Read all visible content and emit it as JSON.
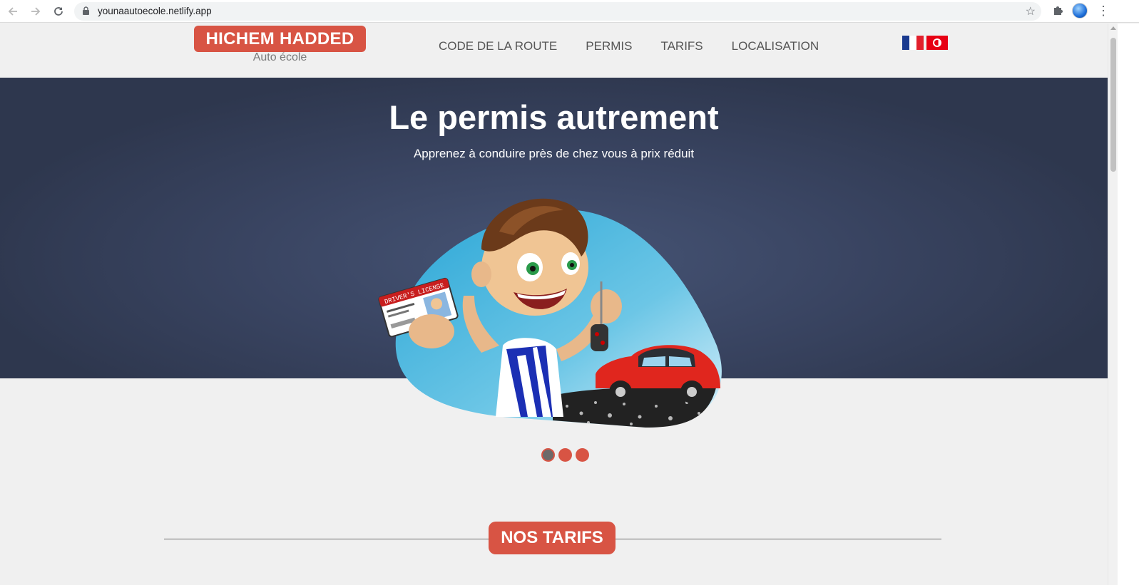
{
  "browser": {
    "url": "younaautoecole.netlify.app",
    "icons": {
      "back": "arrow-left-icon",
      "forward": "arrow-right-icon",
      "reload": "reload-icon",
      "lock": "lock-icon",
      "bookmark": "star-icon",
      "extensions": "puzzle-icon",
      "menu": "kebab-menu-icon"
    }
  },
  "header": {
    "logo_title": "HICHEM HADDED",
    "logo_subtitle": "Auto école",
    "nav": [
      "CODE DE LA ROUTE",
      "PERMIS",
      "TARIFS",
      "LOCALISATION"
    ],
    "languages": [
      "fr",
      "tn"
    ]
  },
  "hero": {
    "title": "Le permis autrement",
    "subtitle": "Apprenez à conduire près de chez vous à prix réduit",
    "license_card_text": "DRIVER'S LICENSE",
    "carousel": {
      "count": 3,
      "active": 1
    }
  },
  "sections": {
    "tarifs_title": "NOS TARIFS"
  },
  "colors": {
    "accent": "#d85444",
    "hero_bg": "#394461",
    "page_bg": "#f0f0f0"
  }
}
